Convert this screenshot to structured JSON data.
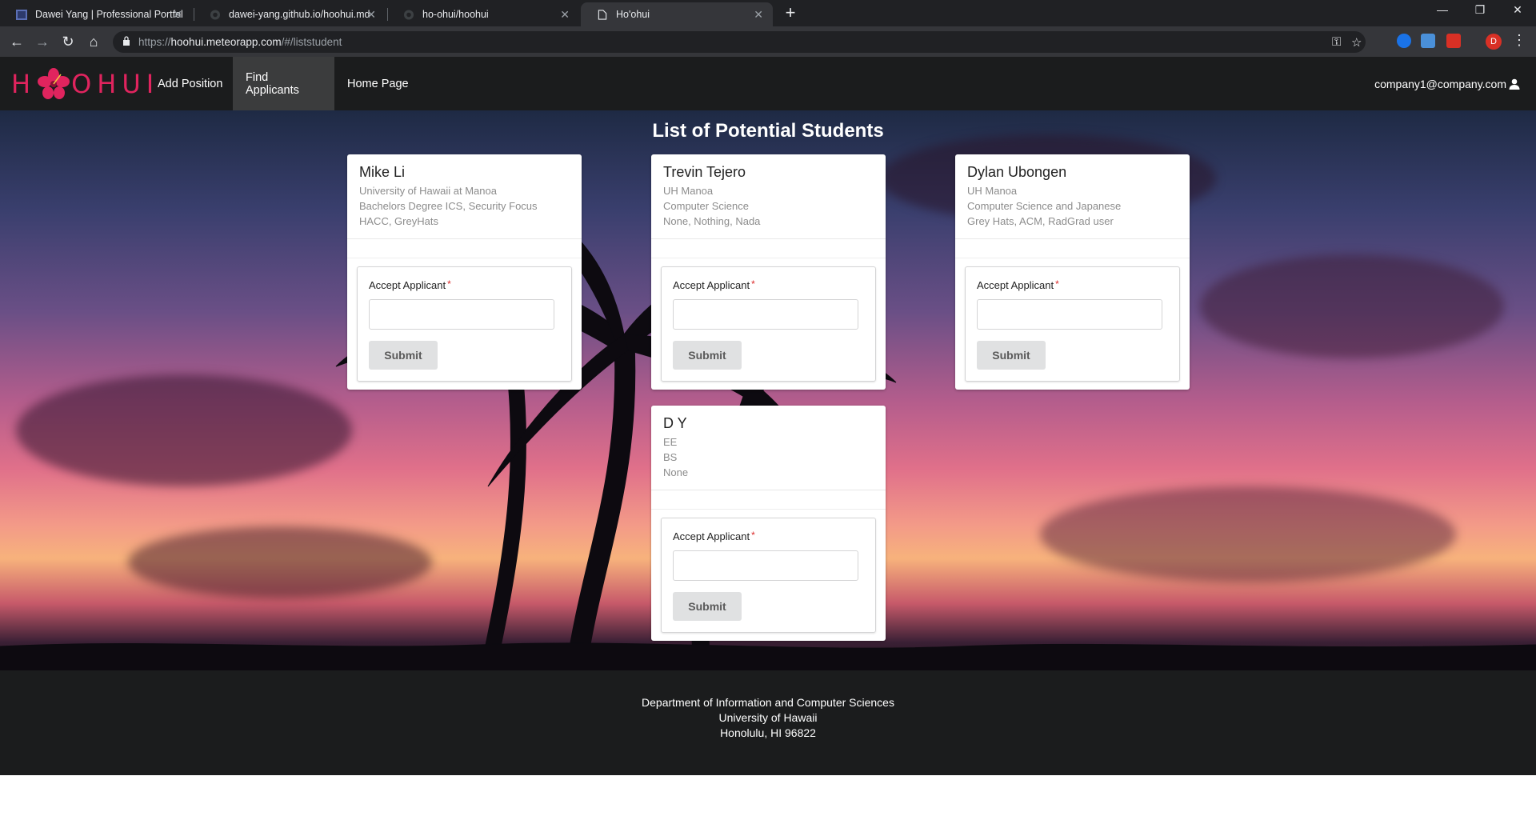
{
  "browser": {
    "tabs": [
      {
        "title": "Dawei Yang | Professional Portfol"
      },
      {
        "title": "dawei-yang.github.io/hoohui.md"
      },
      {
        "title": "ho-ohui/hoohui"
      },
      {
        "title": "Ho'ohui",
        "active": true
      }
    ],
    "url_host": "hoohui.meteorapp.com",
    "url_prefix": "https://",
    "url_path": "/#/liststudent",
    "profile_initial": "D"
  },
  "navbar": {
    "logo_text_left": "H",
    "logo_text_right": "OHUI",
    "items": [
      {
        "label": "Add Position"
      },
      {
        "label": "Find Applicants",
        "active": true
      },
      {
        "label": "Home Page"
      }
    ],
    "user": "company1@company.com"
  },
  "main": {
    "title": "List of Potential Students",
    "students": [
      {
        "name": "Mike Li",
        "school": "University of Hawaii at Manoa",
        "degree": "Bachelors Degree ICS, Security Focus",
        "activities": "HACC, GreyHats"
      },
      {
        "name": "Trevin Tejero",
        "school": "UH Manoa",
        "degree": "Computer Science",
        "activities": "None, Nothing, Nada"
      },
      {
        "name": "Dylan Ubongen",
        "school": "UH Manoa",
        "degree": "Computer Science and Japanese",
        "activities": "Grey Hats, ACM, RadGrad user"
      },
      {
        "name": "D Y",
        "school": "EE",
        "degree": "BS",
        "activities": "None"
      }
    ],
    "form": {
      "label": "Accept Applicant",
      "required_mark": "*",
      "submit_label": "Submit"
    }
  },
  "footer": {
    "line1": "Department of Information and Computer Sciences",
    "line2": "University of Hawaii",
    "line3": "Honolulu, HI 96822"
  },
  "colors": {
    "accent": "#e0245e",
    "navbar_bg": "#1b1c1d",
    "required": "#db2828"
  }
}
